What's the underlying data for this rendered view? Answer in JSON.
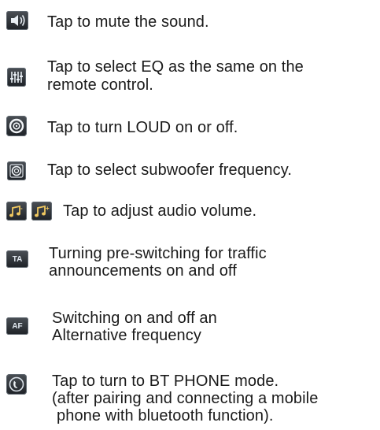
{
  "items": [
    {
      "icon": "speaker-volume-icon",
      "lines": [
        "Tap to mute the sound."
      ]
    },
    {
      "icon": "equalizer-icon",
      "lines": [
        "Tap to select EQ as the same on the",
        "remote control."
      ]
    },
    {
      "icon": "loud-icon",
      "lines": [
        "Tap to turn LOUD on or off."
      ]
    },
    {
      "icon": "subwoofer-icon",
      "lines": [
        "Tap to select subwoofer frequency."
      ]
    },
    {
      "icon": "audio-volume-icon",
      "lines": [
        "Tap to adjust audio volume."
      ]
    },
    {
      "icon": "ta-icon",
      "icon_text": "TA",
      "lines": [
        "Turning pre-switching for traffic",
        "announcements on and off"
      ]
    },
    {
      "icon": "af-icon",
      "icon_text": "AF",
      "lines": [
        "Switching on and off an",
        "Alternative frequency"
      ]
    },
    {
      "icon": "bt-phone-icon",
      "lines": [
        "Tap to turn to BT PHONE mode.",
        "(after pairing and connecting a mobile",
        "phone with bluetooth function)."
      ]
    }
  ]
}
